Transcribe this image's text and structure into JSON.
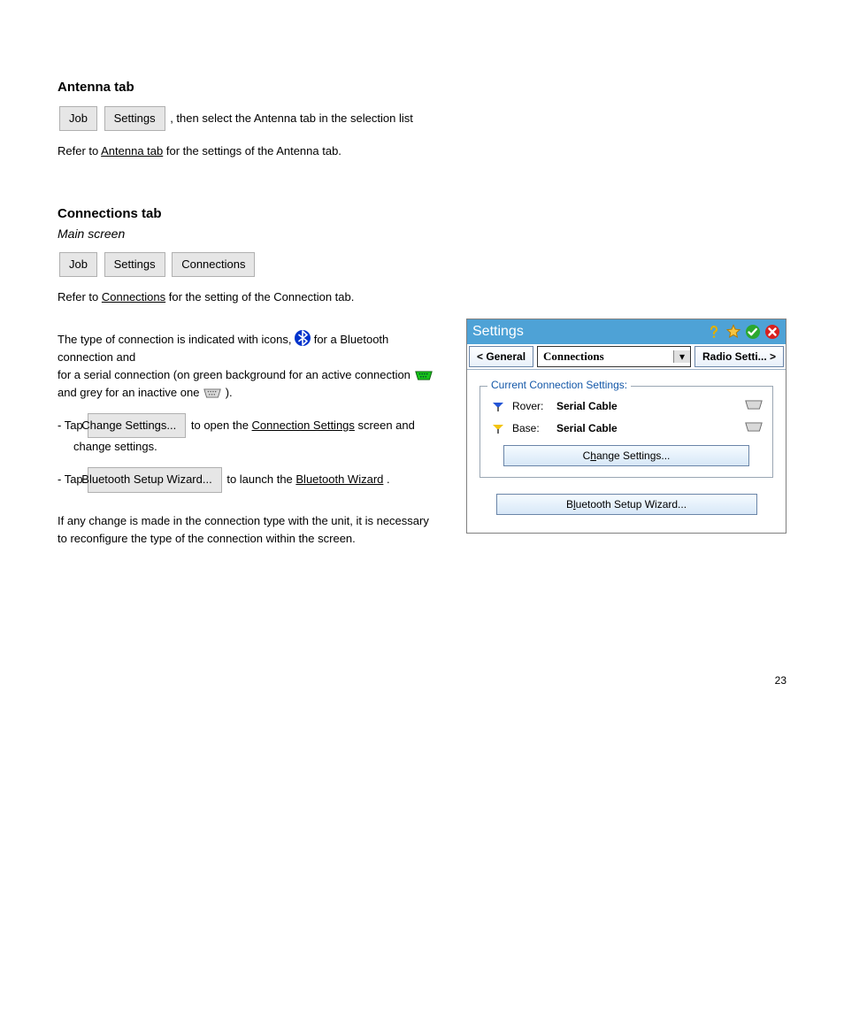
{
  "sectionA": {
    "heading": "Antenna tab",
    "breadcrumb": {
      "b1": "Job",
      "b2": "Settings",
      "tail": ", then select the Antenna tab in the selection list"
    },
    "paraPrefix": "Refer to ",
    "paraLink": "Antenna tab",
    "paraSuffix": " for the settings of the Antenna tab."
  },
  "sectionB": {
    "heading": "Connections tab",
    "subhead": "Main screen",
    "breadcrumb": {
      "b1": "Job",
      "b2": "Settings",
      "b3": "Connections"
    },
    "line1Prefix": "Refer to ",
    "line1Link": "Connections",
    "line1Suffix": " for the setting of the Connection tab.",
    "line2Prefix": "The type of connection is indicated with icons,   ",
    "line2Mid": "   for a Bluetooth connection and   ",
    "line2Suffix": "   for a serial connection (on green background for an active connection      and grey for an inactive one      ).",
    "bullet1Prefix": "- Tap ",
    "bullet1Button": "Change Settings...",
    "bullet1Suffix": "  to open the ",
    "bullet1Link": "Connection Settings",
    "bullet1Tail": " screen and change settings.",
    "bullet2Prefix": "- Tap ",
    "bullet2Button": "Bluetooth Setup Wizard...",
    "bullet2Suffix": "  to launch the ",
    "bullet2Link": "Bluetooth Wizard",
    "bullet2Tail": ".",
    "note": "If any change is made in the connection type with the unit, it is necessary to reconfigure the type of the connection within the screen."
  },
  "dialog": {
    "title": "Settings",
    "tabs": {
      "left": "< General",
      "center": "Connections",
      "right": "Radio Setti... >"
    },
    "groupLegend": "Current Connection Settings:",
    "rows": {
      "rover": {
        "label": "Rover:",
        "value": "Serial Cable"
      },
      "base": {
        "label": "Base:",
        "value": "Serial Cable"
      }
    },
    "buttons": {
      "change": {
        "pre": "C",
        "u": "h",
        "post": "ange  Settings..."
      },
      "wizard": {
        "pre": "B",
        "u": "l",
        "post": "uetooth Setup Wizard..."
      }
    }
  },
  "footer": "23"
}
